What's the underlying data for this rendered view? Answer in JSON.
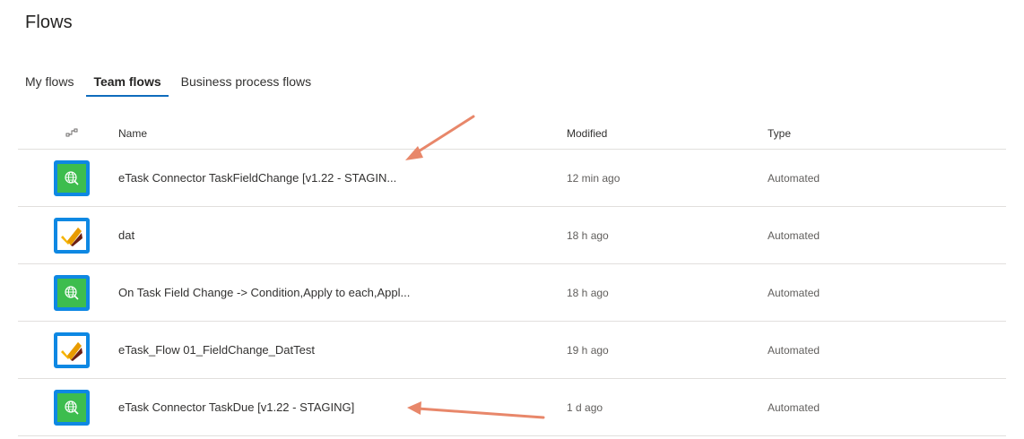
{
  "page": {
    "title": "Flows"
  },
  "tabs": [
    {
      "label": "My flows",
      "active": false
    },
    {
      "label": "Team flows",
      "active": true
    },
    {
      "label": "Business process flows",
      "active": false
    }
  ],
  "table": {
    "headers": {
      "icon": "flow-type-icon",
      "name": "Name",
      "modified": "Modified",
      "type": "Type"
    },
    "rows": [
      {
        "icon": "globe-connector-icon",
        "name": "eTask Connector TaskFieldChange [v1.22 - STAGIN...",
        "modified": "12 min ago",
        "type": "Automated"
      },
      {
        "icon": "checkmark-task-icon",
        "name": "dat",
        "modified": "18 h ago",
        "type": "Automated"
      },
      {
        "icon": "globe-connector-icon",
        "name": "On Task Field Change -> Condition,Apply to each,Appl...",
        "modified": "18 h ago",
        "type": "Automated"
      },
      {
        "icon": "checkmark-task-icon",
        "name": "eTask_Flow 01_FieldChange_DatTest",
        "modified": "19 h ago",
        "type": "Automated"
      },
      {
        "icon": "globe-connector-icon",
        "name": "eTask Connector TaskDue [v1.22 - STAGING]",
        "modified": "1 d ago",
        "type": "Automated"
      }
    ]
  },
  "colors": {
    "accent": "#0f6cbd",
    "icon_border": "#0e88e3",
    "icon_green": "#3dbd4e",
    "annotation_arrow": "#e8876a"
  }
}
